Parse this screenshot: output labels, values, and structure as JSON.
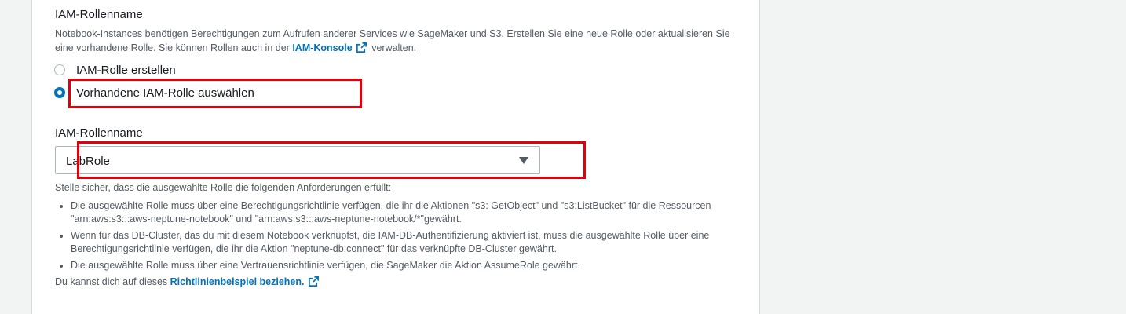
{
  "section": {
    "title": "IAM-Rollenname",
    "description_before_link": "Notebook-Instances benötigen Berechtigungen zum Aufrufen anderer Services wie SageMaker und S3. Erstellen Sie eine neue Rolle oder aktualisieren Sie eine vorhandene Rolle. Sie können Rollen auch in der",
    "description_link": "IAM-Konsole",
    "description_after_link": "verwalten."
  },
  "radios": [
    {
      "label": "IAM-Rolle erstellen",
      "selected": false
    },
    {
      "label": "Vorhandene IAM-Rolle auswählen",
      "selected": true
    }
  ],
  "role_select": {
    "label": "IAM-Rollenname",
    "value": "LabRole"
  },
  "requirements": {
    "intro": "Stelle sicher, dass die ausgewählte Rolle die folgenden Anforderungen erfüllt:",
    "items": [
      "Die ausgewählte Rolle muss über eine Berechtigungsrichtlinie verfügen, die ihr die Aktionen \"s3: GetObject\" und \"s3:ListBucket\" für die Ressourcen \"arn:aws:s3:::aws-neptune-notebook\" und \"arn:aws:s3:::aws-neptune-notebook/*\"gewährt.",
      "Wenn für das DB-Cluster, das du mit diesem Notebook verknüpfst, die IAM-DB-Authentifizierung aktiviert ist, muss die ausgewählte Rolle über eine Berechtigungsrichtlinie verfügen, die ihr die Aktion \"neptune-db:connect\" für das verknüpfte DB-Cluster gewährt.",
      "Die ausgewählte Rolle muss über eine Vertrauensrichtlinie verfügen, die SageMaker die Aktion AssumeRole gewährt."
    ],
    "footer_before_link": "Du kannst dich auf dieses",
    "footer_link": "Richtlinienbeispiel beziehen."
  },
  "colors": {
    "link": "#0073bb",
    "highlight": "#e3000b"
  },
  "icons": {
    "external": "external-link-icon",
    "dropdown": "caret-down-icon"
  }
}
